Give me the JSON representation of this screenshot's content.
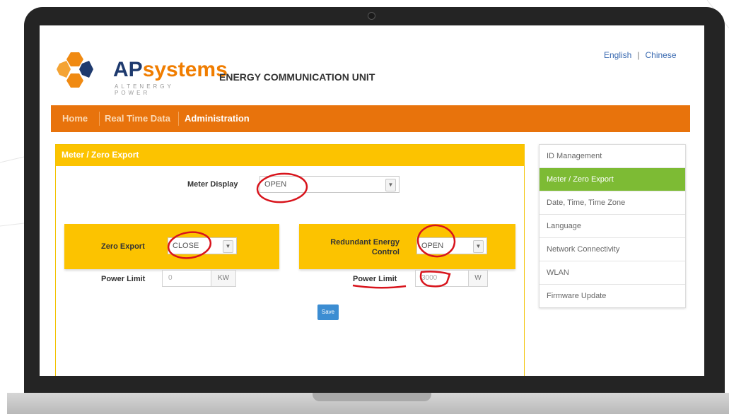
{
  "brand": {
    "name_part1": "AP",
    "name_part2": "systems",
    "tagline": "ALTENERGY POWER",
    "unit_title": "ENERGY COMMUNICATION UNIT"
  },
  "language": {
    "english": "English",
    "separator": "|",
    "chinese": "Chinese"
  },
  "nav": {
    "items": [
      {
        "label": "Home"
      },
      {
        "label": "Real Time Data"
      },
      {
        "label": "Administration"
      }
    ],
    "active": "Administration"
  },
  "panel": {
    "title": "Meter / Zero Export",
    "meter_display": {
      "label": "Meter Display",
      "value": "OPEN"
    },
    "zero_export": {
      "label": "Zero Export",
      "value": "CLOSE"
    },
    "redundant": {
      "label_line1": "Redundant Energy",
      "label_line2": "Control",
      "value": "OPEN"
    },
    "power_limit_left": {
      "label": "Power Limit",
      "value": "0",
      "unit": "KW"
    },
    "power_limit_right": {
      "label": "Power Limit",
      "value": "3000",
      "unit": "W"
    },
    "save_label": "Save"
  },
  "sidebar": {
    "items": [
      {
        "label": "ID Management"
      },
      {
        "label": "Meter / Zero Export"
      },
      {
        "label": "Date, Time, Time Zone"
      },
      {
        "label": "Language"
      },
      {
        "label": "Network Connectivity"
      },
      {
        "label": "WLAN"
      },
      {
        "label": "Firmware Update"
      }
    ],
    "active": "Meter / Zero Export"
  },
  "colors": {
    "nav_orange": "#e8730c",
    "panel_yellow": "#fcc300",
    "sidebar_active_green": "#7dbb34",
    "save_blue": "#3c8dd2",
    "annotation_red": "#d8141c",
    "brand_navy": "#1e3a6e"
  }
}
